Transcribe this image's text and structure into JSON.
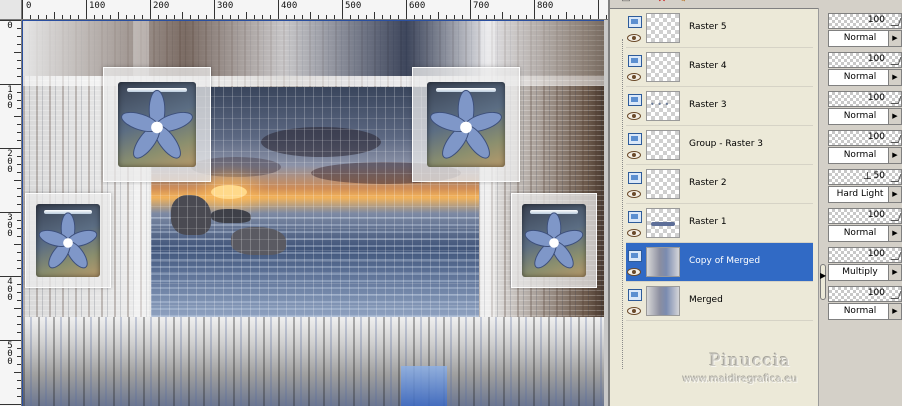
{
  "canvas": {
    "ruler_top_labels": [
      "0",
      "100",
      "200",
      "300",
      "400",
      "500",
      "600",
      "700",
      "800"
    ],
    "ruler_left_labels": [
      "0",
      "100",
      "200",
      "300",
      "400",
      "500"
    ]
  },
  "layers": [
    {
      "name": "Raster 5",
      "thumb": "transparent",
      "selected": false,
      "opacity": "100",
      "blend": "Normal"
    },
    {
      "name": "Raster 4",
      "thumb": "transparent",
      "selected": false,
      "opacity": "100",
      "blend": "Normal"
    },
    {
      "name": "Raster 3",
      "thumb": "dots",
      "selected": false,
      "opacity": "100",
      "blend": "Normal"
    },
    {
      "name": "Group - Raster 3",
      "thumb": "transparent",
      "selected": false,
      "opacity": "100",
      "blend": "Normal"
    },
    {
      "name": "Raster 2",
      "thumb": "transparent",
      "selected": false,
      "opacity": "50",
      "blend": "Hard Light"
    },
    {
      "name": "Raster 1",
      "thumb": "line",
      "selected": false,
      "opacity": "100",
      "blend": "Normal"
    },
    {
      "name": "Copy of Merged",
      "thumb": "photo",
      "selected": true,
      "opacity": "100",
      "blend": "Multiply"
    },
    {
      "name": "Merged",
      "thumb": "photo",
      "selected": false,
      "opacity": "100",
      "blend": "Normal"
    }
  ],
  "watermark": {
    "author": "Pinuccia",
    "site": "www.maidiregrafica.eu"
  },
  "icons": {
    "visibility": "eye-icon",
    "raster_layer": "raster-layer-icon",
    "delete": "delete-layer-icon",
    "dropdown": "dropdown-arrow-icon"
  },
  "colors": {
    "selection": "#316ac5",
    "panel_bg": "#ece9d8",
    "window_bg": "#d4d0c8"
  }
}
